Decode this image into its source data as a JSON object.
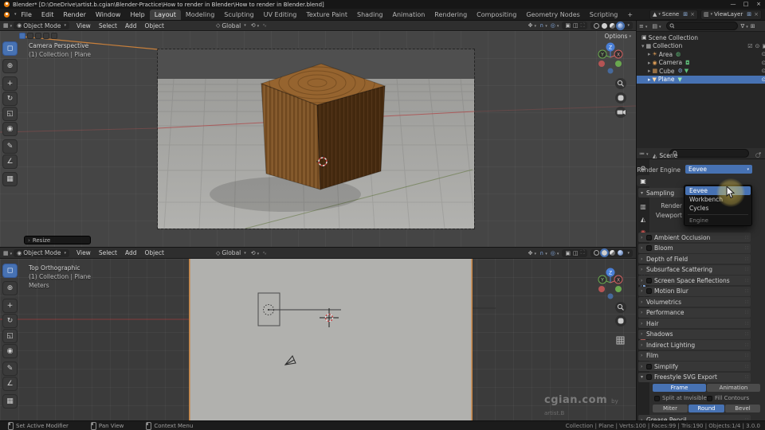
{
  "window": {
    "title": "Blender* [D:\\OneDrive\\artist.b.cgian\\Blender-Practice\\How to render in Blender\\How to render in Blender.blend]",
    "minimize": "—",
    "maximize": "□",
    "close": "×"
  },
  "menubar": {
    "menus": [
      "File",
      "Edit",
      "Render",
      "Window",
      "Help"
    ],
    "workspaces": [
      "Layout",
      "Modeling",
      "Sculpting",
      "UV Editing",
      "Texture Paint",
      "Shading",
      "Animation",
      "Rendering",
      "Compositing",
      "Geometry Nodes",
      "Scripting"
    ],
    "add_workspace": "+",
    "scene": "Scene",
    "view_layer": "ViewLayer"
  },
  "viewport_top": {
    "mode": "Object Mode",
    "menus": [
      "View",
      "Select",
      "Add",
      "Object"
    ],
    "orientation": "Global",
    "options_label": "Options",
    "overlay_title": "Camera Perspective",
    "overlay_subtitle": "(1) Collection | Plane",
    "operator_label": "Resize",
    "axis": {
      "x": "X",
      "y": "Y",
      "z": "Z"
    }
  },
  "viewport_bottom": {
    "mode": "Object Mode",
    "menus": [
      "View",
      "Select",
      "Add",
      "Object"
    ],
    "orientation": "Global",
    "overlay_title": "Top Orthographic",
    "overlay_subtitle": "(1) Collection | Plane",
    "overlay_units": "Meters",
    "watermark": "cgian.com",
    "watermark_by": "by artist.B",
    "axis": {
      "x": "X",
      "y": "Y",
      "z": "Z"
    }
  },
  "toolbar_icons": [
    "◻",
    "⊕",
    "+",
    "↻",
    "◱",
    "◉",
    "✎",
    "∠",
    "▦"
  ],
  "outliner": {
    "root": "Scene Collection",
    "collection": "Collection",
    "items": [
      {
        "label": "Area"
      },
      {
        "label": "Camera"
      },
      {
        "label": "Cube"
      },
      {
        "label": "Plane"
      }
    ]
  },
  "properties": {
    "breadcrumb": "Scene",
    "render_engine_label": "Render Engine",
    "render_engine_value": "Eevee",
    "engine_menu": {
      "items": [
        "Eevee",
        "Workbench",
        "Cycles"
      ],
      "footer": "Engine"
    },
    "sampling": {
      "title": "Sampling",
      "render_label": "Render",
      "viewport_label": "Viewport"
    },
    "sections": [
      {
        "label": "Ambient Occlusion"
      },
      {
        "label": "Bloom"
      },
      {
        "label": "Depth of Field"
      },
      {
        "label": "Subsurface Scattering"
      },
      {
        "label": "Screen Space Reflections"
      },
      {
        "label": "Motion Blur"
      },
      {
        "label": "Volumetrics"
      },
      {
        "label": "Performance"
      },
      {
        "label": "Hair"
      },
      {
        "label": "Shadows"
      },
      {
        "label": "Indirect Lighting"
      },
      {
        "label": "Film"
      },
      {
        "label": "Simplify"
      },
      {
        "label": "Freestyle SVG Export"
      }
    ],
    "freestyle": {
      "frame": "Frame",
      "animation": "Animation",
      "split_at_invisible": "Split at Invisible",
      "fill_contours": "Fill Contours",
      "miter": "Miter",
      "round": "Round",
      "bevel": "Bevel"
    },
    "grease_pencil": "Grease Pencil"
  },
  "statusbar": {
    "left": [
      "Set Active Modifier",
      "Pan View",
      "Context Menu"
    ],
    "right": "Collection | Plane | Verts:100 | Faces:99 | Tris:190 | Objects:1/4 | 3.0.0"
  },
  "colors": {
    "accent": "#4772b3",
    "selection_outline": "#c8823e",
    "cube_wood": "#7d5226"
  }
}
